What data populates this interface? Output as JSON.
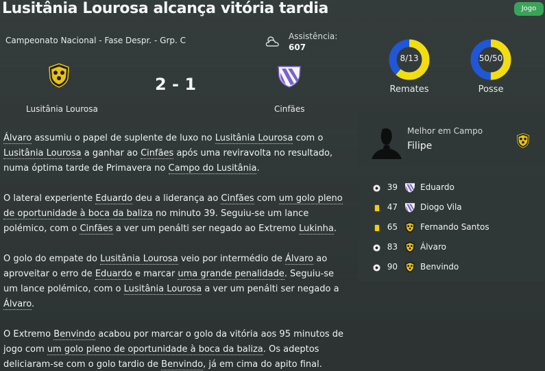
{
  "headline": "Lusitânia Lourosa alcança vitória tardia",
  "tag": "Jogo",
  "match": {
    "competition": "Campeonato Nacional - Fase Despr. - Grp. C",
    "attendance_label": "Assistência:",
    "attendance_value": "607",
    "weather_icon": "cloud-icon",
    "home_team": "Lusitânia Lourosa",
    "away_team": "Cinfães",
    "score": "2 - 1",
    "home_color": "#e8c21a",
    "away_color": "#7a63c9"
  },
  "stats": {
    "shots": {
      "label": "Remates",
      "text": "8/13",
      "fraction": 0.615
    },
    "possession": {
      "label": "Posse",
      "text": "50/50",
      "fraction": 0.5
    },
    "ring_colors": {
      "primary": "#f2dd10",
      "secondary": "#1f57d6"
    }
  },
  "man_of_match": {
    "title": "Melhor em Campo",
    "name": "Filipe"
  },
  "events": [
    {
      "type": "goal",
      "icon": "ball-icon",
      "minute": "39",
      "team": "away",
      "player": "Eduardo"
    },
    {
      "type": "yellow",
      "icon": "yellow-card-icon",
      "minute": "47",
      "team": "away",
      "player": "Diogo Vila"
    },
    {
      "type": "yellow",
      "icon": "yellow-card-icon",
      "minute": "65",
      "team": "home",
      "player": "Fernando Santos"
    },
    {
      "type": "goal",
      "icon": "ball-icon",
      "minute": "83",
      "team": "home",
      "player": "Álvaro"
    },
    {
      "type": "goal",
      "icon": "ball-icon",
      "minute": "90",
      "team": "home",
      "player": "Benvindo"
    }
  ],
  "article": {
    "p1": {
      "a": "Álvaro",
      "b": " assumiu o papel de suplente de luxo no ",
      "c": "Lusitânia Lourosa",
      "d": " com o ",
      "e": "Lusitânia Lourosa",
      "f": " a ganhar ao ",
      "g": "Cinfães",
      "h": " após uma reviravolta no resultado, numa óptima tarde de Primavera no ",
      "i": "Campo do Lusitânia",
      "j": "."
    },
    "p2": {
      "a": "O lateral experiente ",
      "b": "Eduardo",
      "c": " deu a liderança ao ",
      "d": "Cinfães",
      "e": " com ",
      "f": "um golo pleno de oportunidade à boca da baliza",
      "g": " no minuto 39. Seguiu-se um lance polémico, com o ",
      "h": "Cinfães",
      "i": " a ver um penálti ser negado ao Extremo ",
      "j": "Lukinha",
      "k": "."
    },
    "p3": {
      "a": "O golo do empate do ",
      "b": "Lusitânia Lourosa",
      "c": " veio por intermédio de ",
      "d": "Álvaro",
      "e": " ao aproveitar o erro de ",
      "f": "Eduardo",
      "g": " e marcar ",
      "h": "uma grande penalidade",
      "i": ". Seguiu-se um lance polémico, com o ",
      "j": "Lusitânia Lourosa",
      "k": " a ver um penálti ser negado a ",
      "l": "Álvaro",
      "m": "."
    },
    "p4": {
      "a": "O Extremo ",
      "b": "Benvindo",
      "c": " acabou por marcar o golo da vitória aos 95 minutos de jogo com ",
      "d": "um golo pleno de oportunidade à boca da baliza",
      "e": ". Os adeptos deliciaram-se com o golo tardio de ",
      "f": "Benvindo",
      "g": ", já em cima do apito final."
    }
  }
}
